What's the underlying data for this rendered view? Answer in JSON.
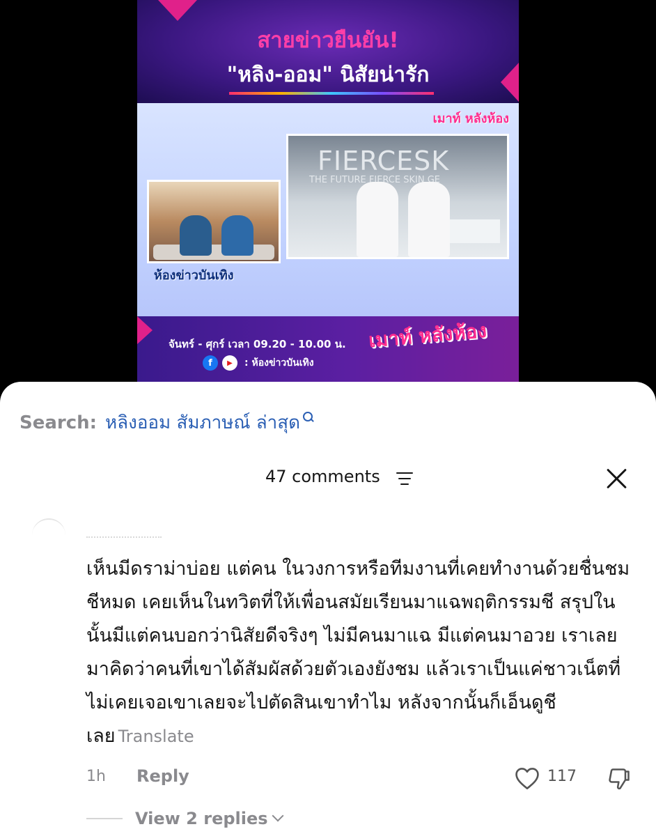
{
  "video": {
    "headline_line1": "สายข่าวยืนยัน!",
    "headline_line2": "\"หลิง-ออม\" นิสัยน่ารัก",
    "event_sign": "FIERCESK",
    "event_sign_sub": "THE FUTURE FIERCE SKIN GE",
    "studio_logo": "ห้องข่าวบันเทิง",
    "corner_logo": "เมาท์ หลังห้อง",
    "schedule": "จันทร์ - ศุกร์ เวลา 09.20 - 10.00 น.",
    "social_label": ": ห้องข่าวบันเทิง",
    "bottom_logo": "เมาท์ หลังห้อง"
  },
  "search": {
    "label": "Search:",
    "query": "หลิงออม สัมภาษณ์ ล่าสุด"
  },
  "comments": {
    "count_label": "47 comments"
  },
  "comment": {
    "text": "เห็นมีดราม่าบ่อย แต่คน ในวงการหรือทีมงานที่เคยทำงานด้วยชื่นชมชีหมด เคยเห็นในทวิตที่ให้เพื่อนสมัยเรียนมาแฉพฤติกรรมชี สรุปในนั้นมีแต่คนบอกว่านิสัยดีจริงๆ ไม่มีคนมาแฉ มีแต่คนมาอวย เราเลยมาคิดว่าคนที่เขาได้สัมผัสด้วยตัวเองยังชม แล้วเราเป็นแค่ชาวเน็ตที่ไม่เคยเจอเขาเลยจะไปตัดสินเขาทำไม หลังจากนั้นก็เอ็นดูชีเลย",
    "translate_label": "Translate",
    "time": "1h",
    "reply_label": "Reply",
    "likes": "117",
    "view_replies": "View 2 replies"
  }
}
